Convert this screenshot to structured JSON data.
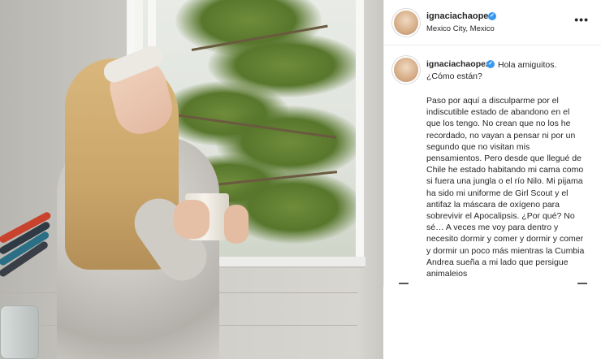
{
  "post": {
    "author": {
      "username": "ignaciachaopez",
      "location": "Mexico City, Mexico",
      "verified": true
    },
    "more_icon": "more-horizontal-icon",
    "caption": {
      "username": "ignaciachaopez",
      "intro_line1": "Hola amiguitos.",
      "intro_line2": "¿Cómo están?",
      "body": "Paso por aquí a disculparme por el indiscutible estado de abandono en el que los tengo. No crean que no los he recordado, no vayan a pensar ni por un segundo que no visitan mis pensamientos. Pero desde que llegué de Chile he estado habitando mi cama como si fuera una jungla o el río Nilo. Mi pijama ha sido mi uniforme de Girl Scout y el antifaz la máscara de oxígeno para sobrevivir el Apocalipsis. ¿Por qué? No sé… A veces me voy para dentro y necesito dormir y comer y dormir y comer y dormir un poco más mientras la Cumbia Andrea sueña a mi lado que persigue animalejos"
    },
    "image": {
      "description_icon": "post-photo"
    }
  }
}
